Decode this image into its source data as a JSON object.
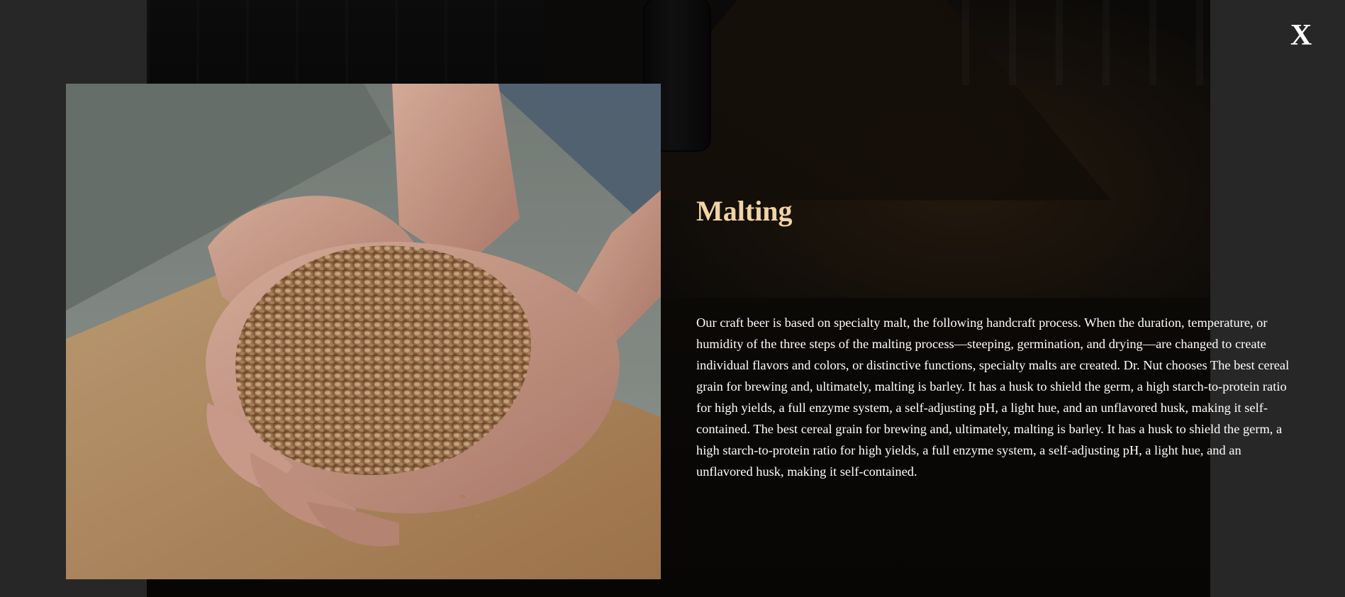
{
  "modal": {
    "close_label": "X",
    "title": "Malting",
    "body": "Our craft beer is based on specialty malt, the following handcraft process. When the duration, temperature, or humidity of the three steps of the malting process—steeping, germination, and drying—are changed to create individual flavors and colors, or distinctive functions, specialty malts are created. Dr. Nut chooses The best cereal grain for brewing and, ultimately, malting is barley. It has a husk to shield the germ, a high starch-to-protein ratio for high yields, a full enzyme system, a self-adjusting pH, a light hue, and an unflavored husk, making it self-contained. The best cereal grain for brewing and, ultimately, malting is barley. It has a husk to shield the germ, a high starch-to-protein ratio for high yields, a full enzyme system, a self-adjusting pH, a light hue, and an unflavored husk, making it self-contained.",
    "image_subject": "hands-holding-malt-grains"
  },
  "colors": {
    "page_background": "#272727",
    "title_color": "#f2d3a4",
    "body_text_color": "#ffffff",
    "close_color": "#ffffff"
  },
  "icons": {
    "close": "close-x-icon"
  }
}
